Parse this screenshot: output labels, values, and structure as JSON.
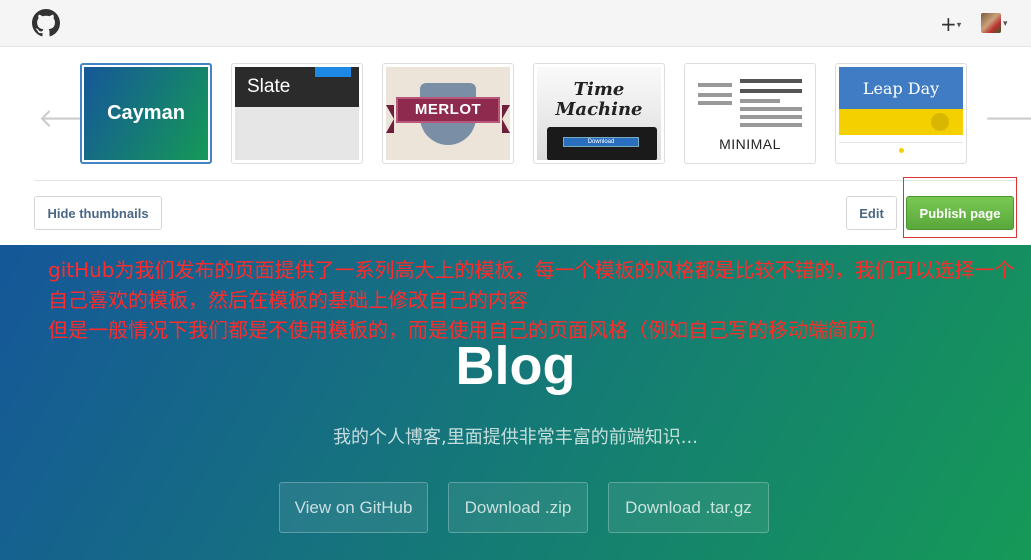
{
  "topbar": {
    "logo_icon": "github-octocat-icon",
    "new_menu_icon": "+",
    "caret": "▾"
  },
  "picker": {
    "prev_arrow": "🡐",
    "next_arrow": "🡒",
    "themes": [
      {
        "name": "Cayman"
      },
      {
        "name": "Slate"
      },
      {
        "name": "MERLOT"
      },
      {
        "name": "Time",
        "name2": "Machine",
        "button": "Download"
      },
      {
        "name": "MINIMAL"
      },
      {
        "name": "Leap Day"
      }
    ],
    "selected_theme": "Cayman",
    "hide_thumbnails": "Hide thumbnails",
    "edit": "Edit",
    "publish": "Publish page",
    "colors": {
      "publish": "#5aa83b",
      "highlight_box": "#dd3333"
    }
  },
  "hero": {
    "note_line1": "gitHub为我们发布的页面提供了一系列高大上的模板，每一个模板的风格都是比较不错的，我们可以选择一个自己喜欢的模板，然后在模板的基础上修改自己的内容",
    "note_line2": "但是一般情况下我们都是不使用模板的，而是使用自己的页面风格（例如自己写的移动端简历）",
    "title": "Blog",
    "subtitle": "我的个人博客,里面提供非常丰富的前端知识...",
    "buttons": [
      "View on GitHub",
      "Download .zip",
      "Download .tar.gz"
    ],
    "colors": {
      "gradient_start": "#155799",
      "gradient_end": "#159957",
      "note": "#ff2b2b"
    }
  }
}
